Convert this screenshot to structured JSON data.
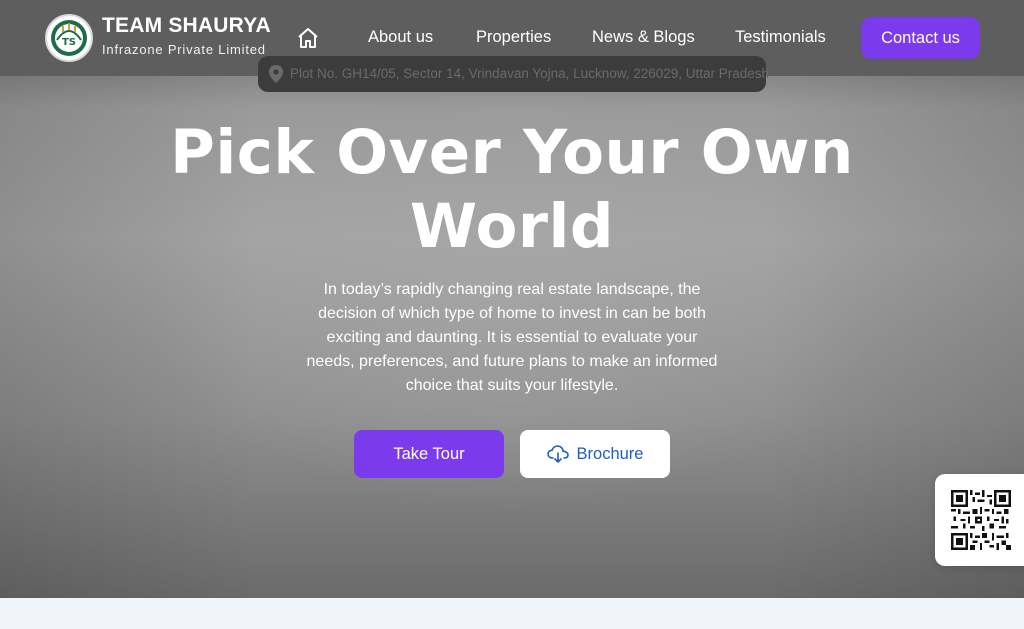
{
  "brand": {
    "title": "TEAM SHAURYA",
    "subtitle": "Infrazone Private Limited",
    "logo_text": "TS",
    "logo_icon": "logo-icon"
  },
  "nav": {
    "home_icon": "home-icon",
    "links": [
      "About us",
      "Properties",
      "News & Blogs",
      "Testimonials"
    ],
    "cta": "Contact us"
  },
  "address": {
    "icon": "map-pin-icon",
    "text": "Plot No. GH14/05, Sector 14, Vrindavan Yojna, Lucknow, 226029, Uttar Pradesh"
  },
  "hero": {
    "title_line1": "Pick Over Your Own",
    "title_line2": "World",
    "description": "In today’s rapidly changing real estate landscape, the decision of which type of home to invest in can be both exciting and daunting. It is essential to evaluate your needs, preferences, and future plans to make an informed choice that suits your lifestyle.",
    "primary_button": "Take Tour",
    "secondary_button": "Brochure",
    "secondary_icon": "cloud-download-icon"
  },
  "qr": {
    "icon": "qr-code-icon"
  },
  "colors": {
    "accent": "#7c3aed",
    "navbar": "#5e5e5e",
    "link_blue": "#1d5fbf"
  }
}
